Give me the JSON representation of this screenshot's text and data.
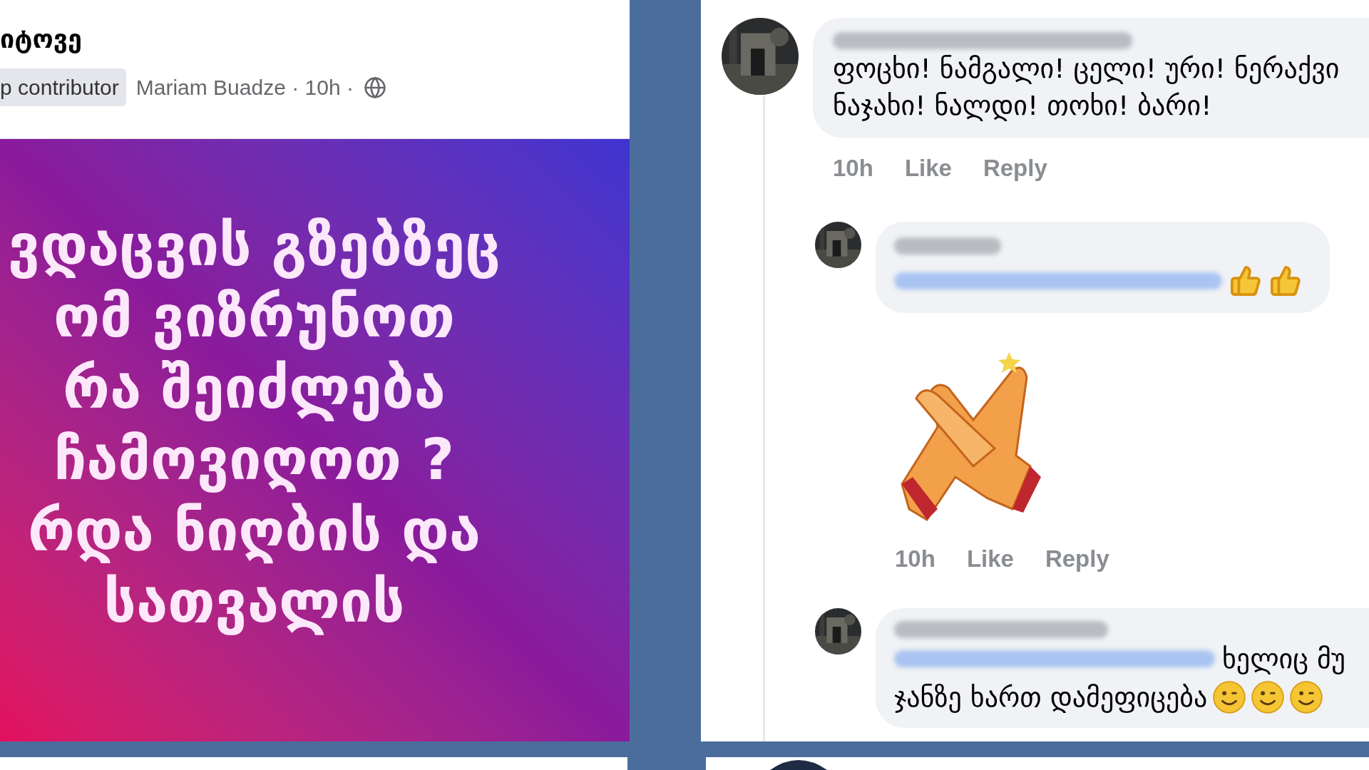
{
  "post": {
    "title": "იტოვე",
    "badge": "p contributor",
    "meta": "Mariam Buadze · 10h ·",
    "image_lines": [
      "ვდაცვის გზებზეც",
      "ომ ვიზრუნოთ",
      "რა შეიძლება",
      "ჩამოვიღოთ ?",
      "რდა ნიღბის და",
      "სათვალის"
    ]
  },
  "comments": [
    {
      "kind": "text",
      "lines": [
        "ფოცხი! ნამგალი! ცელი! ური! ნერაქვი",
        "ნაჯახი! ნალდი! თოხი! ბარი!"
      ],
      "time": "10h",
      "actions": [
        "Like",
        "Reply"
      ],
      "replies": [
        {
          "kind": "thumbs",
          "time": "10h",
          "actions": [
            "Like",
            "Reply"
          ]
        },
        {
          "kind": "wink",
          "lines": [
            "ხელიც მუ",
            "ჯანზე ხართ დამეფიცება"
          ]
        }
      ]
    }
  ]
}
